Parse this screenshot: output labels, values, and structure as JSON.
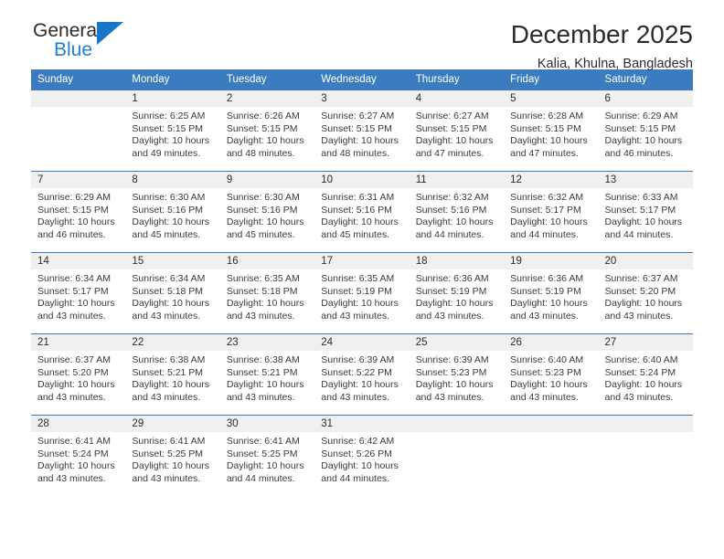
{
  "brand": {
    "name_part1": "General",
    "name_part2": "Blue",
    "logo_icon": "triangle-icon"
  },
  "header": {
    "month_title": "December 2025",
    "location": "Kalia, Khulna, Bangladesh"
  },
  "colors": {
    "header_blue": "#3a7cbe",
    "brand_blue": "#1f7fd0",
    "daynum_background": "#f0f0f0",
    "text": "#2b2b2b"
  },
  "weekday_headers": [
    "Sunday",
    "Monday",
    "Tuesday",
    "Wednesday",
    "Thursday",
    "Friday",
    "Saturday"
  ],
  "labels": {
    "sunrise_prefix": "Sunrise:",
    "sunset_prefix": "Sunset:",
    "daylight_prefix": "Daylight:"
  },
  "weeks": [
    [
      {
        "empty": true,
        "date": "",
        "sunrise": "",
        "sunset": "",
        "daylight": ""
      },
      {
        "empty": false,
        "date": "1",
        "sunrise": "Sunrise: 6:25 AM",
        "sunset": "Sunset: 5:15 PM",
        "daylight": "Daylight: 10 hours and 49 minutes."
      },
      {
        "empty": false,
        "date": "2",
        "sunrise": "Sunrise: 6:26 AM",
        "sunset": "Sunset: 5:15 PM",
        "daylight": "Daylight: 10 hours and 48 minutes."
      },
      {
        "empty": false,
        "date": "3",
        "sunrise": "Sunrise: 6:27 AM",
        "sunset": "Sunset: 5:15 PM",
        "daylight": "Daylight: 10 hours and 48 minutes."
      },
      {
        "empty": false,
        "date": "4",
        "sunrise": "Sunrise: 6:27 AM",
        "sunset": "Sunset: 5:15 PM",
        "daylight": "Daylight: 10 hours and 47 minutes."
      },
      {
        "empty": false,
        "date": "5",
        "sunrise": "Sunrise: 6:28 AM",
        "sunset": "Sunset: 5:15 PM",
        "daylight": "Daylight: 10 hours and 47 minutes."
      },
      {
        "empty": false,
        "date": "6",
        "sunrise": "Sunrise: 6:29 AM",
        "sunset": "Sunset: 5:15 PM",
        "daylight": "Daylight: 10 hours and 46 minutes."
      }
    ],
    [
      {
        "empty": false,
        "date": "7",
        "sunrise": "Sunrise: 6:29 AM",
        "sunset": "Sunset: 5:15 PM",
        "daylight": "Daylight: 10 hours and 46 minutes."
      },
      {
        "empty": false,
        "date": "8",
        "sunrise": "Sunrise: 6:30 AM",
        "sunset": "Sunset: 5:16 PM",
        "daylight": "Daylight: 10 hours and 45 minutes."
      },
      {
        "empty": false,
        "date": "9",
        "sunrise": "Sunrise: 6:30 AM",
        "sunset": "Sunset: 5:16 PM",
        "daylight": "Daylight: 10 hours and 45 minutes."
      },
      {
        "empty": false,
        "date": "10",
        "sunrise": "Sunrise: 6:31 AM",
        "sunset": "Sunset: 5:16 PM",
        "daylight": "Daylight: 10 hours and 45 minutes."
      },
      {
        "empty": false,
        "date": "11",
        "sunrise": "Sunrise: 6:32 AM",
        "sunset": "Sunset: 5:16 PM",
        "daylight": "Daylight: 10 hours and 44 minutes."
      },
      {
        "empty": false,
        "date": "12",
        "sunrise": "Sunrise: 6:32 AM",
        "sunset": "Sunset: 5:17 PM",
        "daylight": "Daylight: 10 hours and 44 minutes."
      },
      {
        "empty": false,
        "date": "13",
        "sunrise": "Sunrise: 6:33 AM",
        "sunset": "Sunset: 5:17 PM",
        "daylight": "Daylight: 10 hours and 44 minutes."
      }
    ],
    [
      {
        "empty": false,
        "date": "14",
        "sunrise": "Sunrise: 6:34 AM",
        "sunset": "Sunset: 5:17 PM",
        "daylight": "Daylight: 10 hours and 43 minutes."
      },
      {
        "empty": false,
        "date": "15",
        "sunrise": "Sunrise: 6:34 AM",
        "sunset": "Sunset: 5:18 PM",
        "daylight": "Daylight: 10 hours and 43 minutes."
      },
      {
        "empty": false,
        "date": "16",
        "sunrise": "Sunrise: 6:35 AM",
        "sunset": "Sunset: 5:18 PM",
        "daylight": "Daylight: 10 hours and 43 minutes."
      },
      {
        "empty": false,
        "date": "17",
        "sunrise": "Sunrise: 6:35 AM",
        "sunset": "Sunset: 5:19 PM",
        "daylight": "Daylight: 10 hours and 43 minutes."
      },
      {
        "empty": false,
        "date": "18",
        "sunrise": "Sunrise: 6:36 AM",
        "sunset": "Sunset: 5:19 PM",
        "daylight": "Daylight: 10 hours and 43 minutes."
      },
      {
        "empty": false,
        "date": "19",
        "sunrise": "Sunrise: 6:36 AM",
        "sunset": "Sunset: 5:19 PM",
        "daylight": "Daylight: 10 hours and 43 minutes."
      },
      {
        "empty": false,
        "date": "20",
        "sunrise": "Sunrise: 6:37 AM",
        "sunset": "Sunset: 5:20 PM",
        "daylight": "Daylight: 10 hours and 43 minutes."
      }
    ],
    [
      {
        "empty": false,
        "date": "21",
        "sunrise": "Sunrise: 6:37 AM",
        "sunset": "Sunset: 5:20 PM",
        "daylight": "Daylight: 10 hours and 43 minutes."
      },
      {
        "empty": false,
        "date": "22",
        "sunrise": "Sunrise: 6:38 AM",
        "sunset": "Sunset: 5:21 PM",
        "daylight": "Daylight: 10 hours and 43 minutes."
      },
      {
        "empty": false,
        "date": "23",
        "sunrise": "Sunrise: 6:38 AM",
        "sunset": "Sunset: 5:21 PM",
        "daylight": "Daylight: 10 hours and 43 minutes."
      },
      {
        "empty": false,
        "date": "24",
        "sunrise": "Sunrise: 6:39 AM",
        "sunset": "Sunset: 5:22 PM",
        "daylight": "Daylight: 10 hours and 43 minutes."
      },
      {
        "empty": false,
        "date": "25",
        "sunrise": "Sunrise: 6:39 AM",
        "sunset": "Sunset: 5:23 PM",
        "daylight": "Daylight: 10 hours and 43 minutes."
      },
      {
        "empty": false,
        "date": "26",
        "sunrise": "Sunrise: 6:40 AM",
        "sunset": "Sunset: 5:23 PM",
        "daylight": "Daylight: 10 hours and 43 minutes."
      },
      {
        "empty": false,
        "date": "27",
        "sunrise": "Sunrise: 6:40 AM",
        "sunset": "Sunset: 5:24 PM",
        "daylight": "Daylight: 10 hours and 43 minutes."
      }
    ],
    [
      {
        "empty": false,
        "date": "28",
        "sunrise": "Sunrise: 6:41 AM",
        "sunset": "Sunset: 5:24 PM",
        "daylight": "Daylight: 10 hours and 43 minutes."
      },
      {
        "empty": false,
        "date": "29",
        "sunrise": "Sunrise: 6:41 AM",
        "sunset": "Sunset: 5:25 PM",
        "daylight": "Daylight: 10 hours and 43 minutes."
      },
      {
        "empty": false,
        "date": "30",
        "sunrise": "Sunrise: 6:41 AM",
        "sunset": "Sunset: 5:25 PM",
        "daylight": "Daylight: 10 hours and 44 minutes."
      },
      {
        "empty": false,
        "date": "31",
        "sunrise": "Sunrise: 6:42 AM",
        "sunset": "Sunset: 5:26 PM",
        "daylight": "Daylight: 10 hours and 44 minutes."
      },
      {
        "empty": true,
        "date": "",
        "sunrise": "",
        "sunset": "",
        "daylight": ""
      },
      {
        "empty": true,
        "date": "",
        "sunrise": "",
        "sunset": "",
        "daylight": ""
      },
      {
        "empty": true,
        "date": "",
        "sunrise": "",
        "sunset": "",
        "daylight": ""
      }
    ]
  ]
}
